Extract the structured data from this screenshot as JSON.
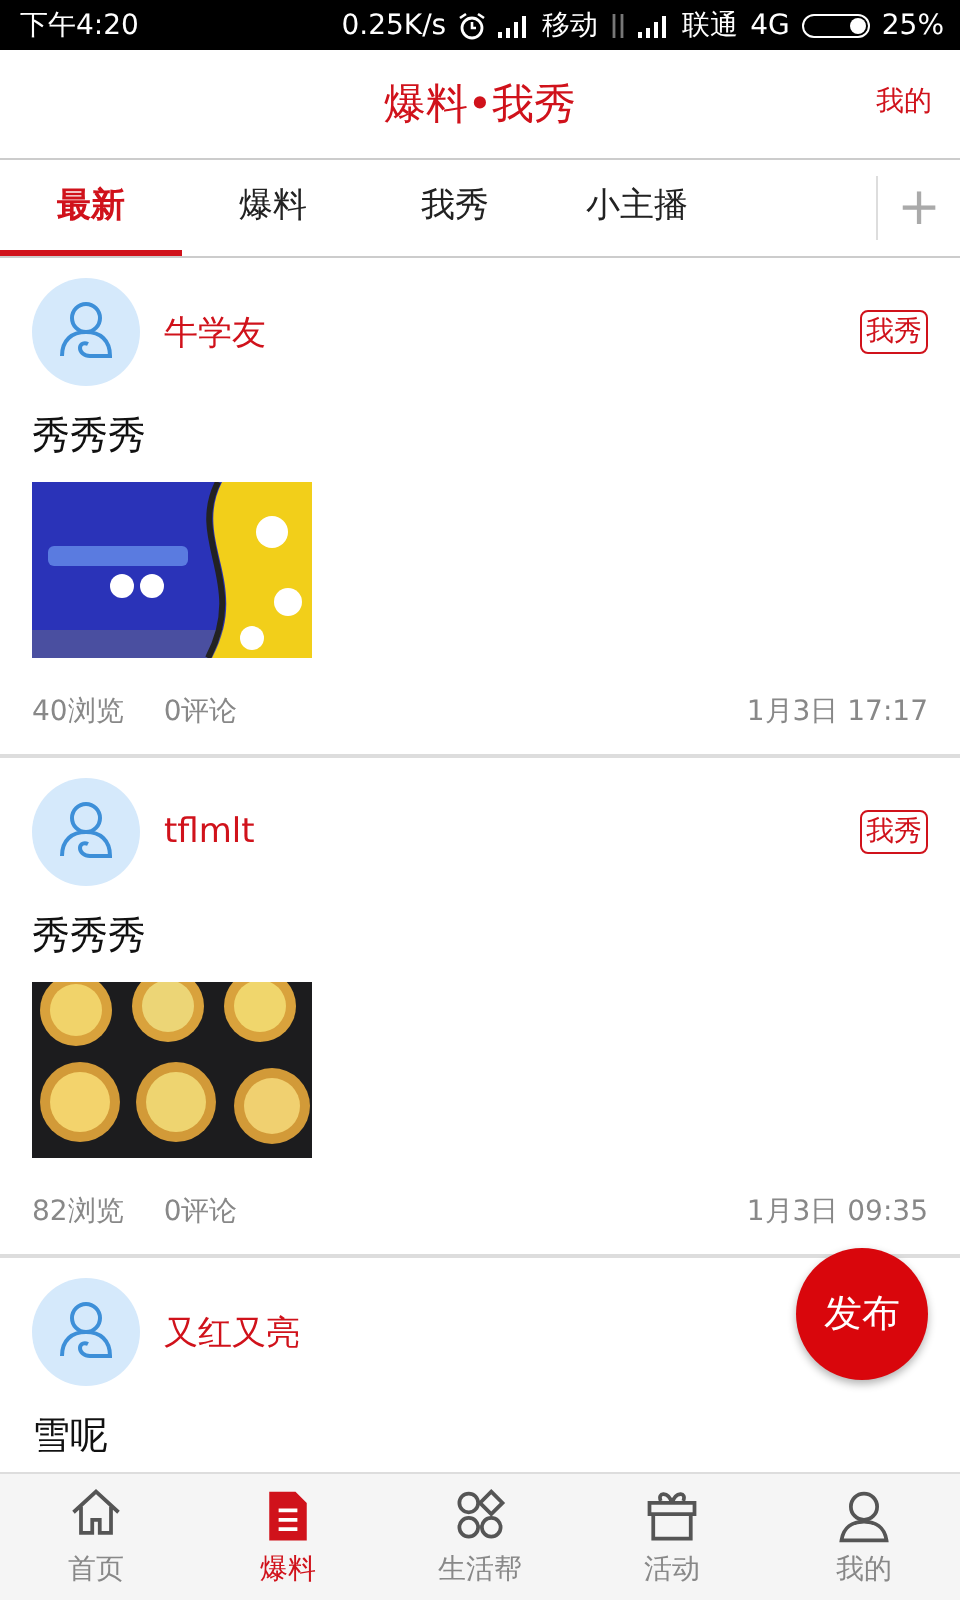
{
  "status_bar": {
    "time": "下午4:20",
    "speed": "0.25K/s",
    "carrier_1": "移动",
    "carrier_2": "联通",
    "network": "4G",
    "battery": "25%"
  },
  "header": {
    "title": "爆料•我秀",
    "action": "我的"
  },
  "tabs": [
    {
      "label": "最新",
      "selected": true
    },
    {
      "label": "爆料",
      "selected": false
    },
    {
      "label": "我秀",
      "selected": false
    },
    {
      "label": "小主播",
      "selected": false
    }
  ],
  "add_tab": "+",
  "posts": [
    {
      "author": "牛学友",
      "badge": "我秀",
      "text": "秀秀秀",
      "views": "40浏览",
      "comments": "0评论",
      "time": "1月3日 17:17"
    },
    {
      "author": "tflmlt",
      "badge": "我秀",
      "text": "秀秀秀",
      "views": "82浏览",
      "comments": "0评论",
      "time": "1月3日 09:35"
    },
    {
      "author": "又红又亮",
      "text": "雪呢"
    }
  ],
  "fab": "发布",
  "bottom_nav": [
    {
      "label": "首页",
      "selected": false
    },
    {
      "label": "爆料",
      "selected": true
    },
    {
      "label": "生活帮",
      "selected": false
    },
    {
      "label": "活动",
      "selected": false
    },
    {
      "label": "我的",
      "selected": false
    }
  ]
}
